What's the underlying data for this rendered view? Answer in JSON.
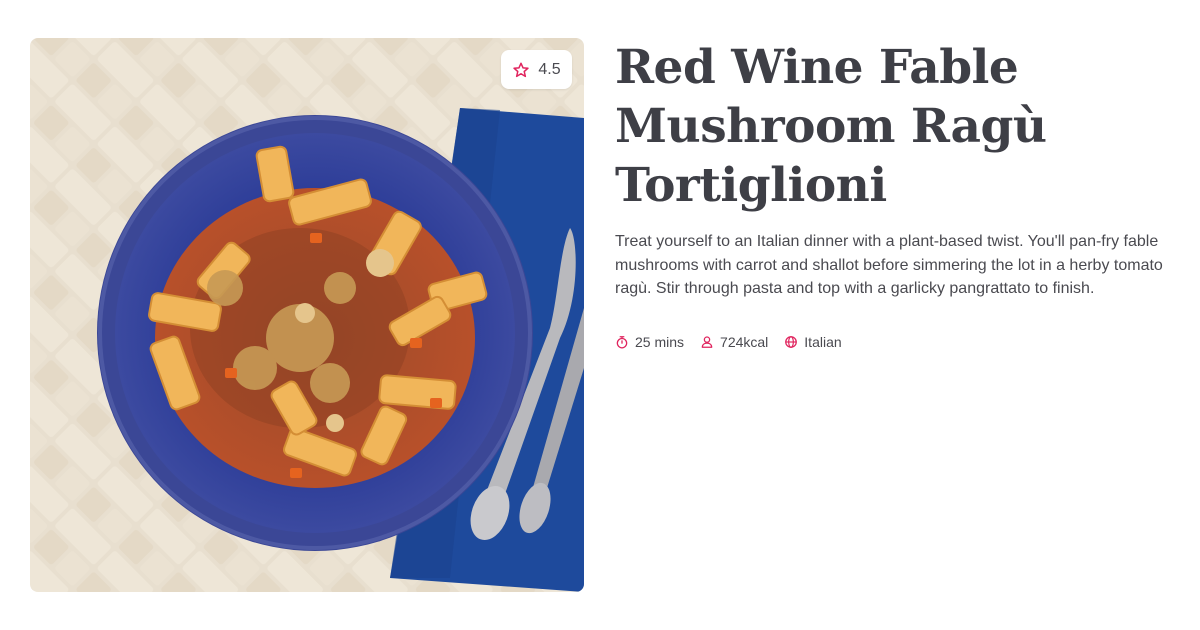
{
  "recipe": {
    "title": "Red Wine Fable Mushroom Ragù Tortiglioni",
    "description": "Treat yourself to an Italian dinner with a plant-based twist. You'll pan-fry fable mushrooms with carrot and shallot before simmering the lot in a herby tomato ragù. Stir through pasta and top with a garlicky pangrattato to finish.",
    "rating": "4.5",
    "meta": {
      "time": "25 mins",
      "calories": "724kcal",
      "cuisine": "Italian"
    }
  },
  "colors": {
    "accent": "#e0245e",
    "title": "#3e3f46",
    "text": "#4a4a50",
    "bowl": "#2b3a8f",
    "napkin": "#1f4ea0",
    "tile": "#e6dccb"
  },
  "icons": {
    "rating": "star-icon",
    "time": "timer-icon",
    "calories": "person-icon",
    "cuisine": "globe-icon"
  }
}
